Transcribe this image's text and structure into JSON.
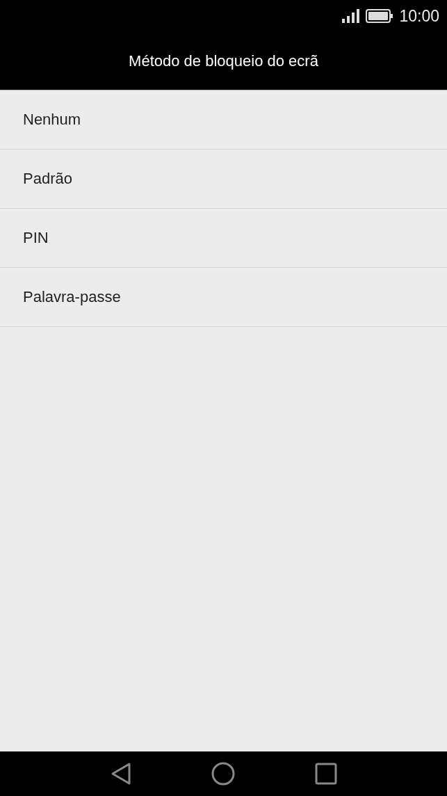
{
  "status_bar": {
    "time": "10:00"
  },
  "header": {
    "title": "Método de bloqueio do ecrã"
  },
  "options": [
    {
      "label": "Nenhum"
    },
    {
      "label": "Padrão"
    },
    {
      "label": "PIN"
    },
    {
      "label": "Palavra-passe"
    }
  ]
}
